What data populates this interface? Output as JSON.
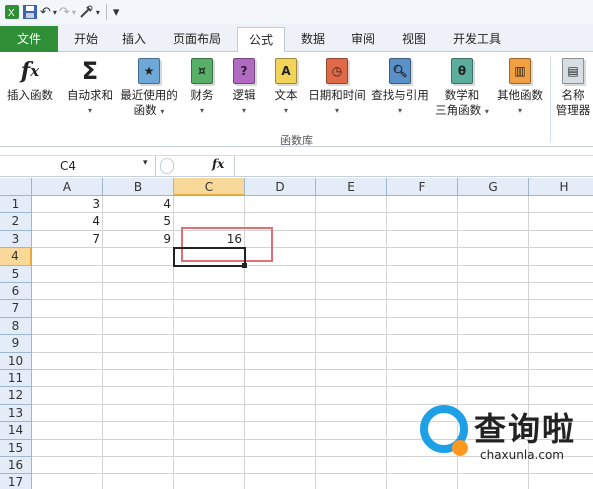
{
  "qat": {
    "undo": "↶",
    "redo": "↷",
    "customize": "▾"
  },
  "tabs": {
    "file": "文件",
    "home": "开始",
    "insert": "插入",
    "layout": "页面布局",
    "formulas": "公式",
    "data": "数据",
    "review": "审阅",
    "view": "视图",
    "developer": "开发工具"
  },
  "ribbon": {
    "insert_fn": "插入函数",
    "autosum": "自动求和",
    "recent": "最近使用的",
    "recent2": "函数",
    "financial": "财务",
    "logical": "逻辑",
    "text": "文本",
    "datetime": "日期和时间",
    "lookup": "查找与引用",
    "math": "数学和",
    "math2": "三角函数",
    "more": "其他函数",
    "name": "名称",
    "name2": "管理器",
    "group_label": "函数库"
  },
  "formula_bar": {
    "name_box": "C4",
    "fx": "fx",
    "content": ""
  },
  "columns": [
    "A",
    "B",
    "C",
    "D",
    "E",
    "F",
    "G",
    "H"
  ],
  "rows": [
    "1",
    "2",
    "3",
    "4",
    "5",
    "6",
    "7",
    "8",
    "9",
    "10",
    "11",
    "12",
    "13",
    "14",
    "15",
    "16",
    "17"
  ],
  "cells": {
    "A1": "3",
    "B1": "4",
    "A2": "4",
    "B2": "5",
    "A3": "7",
    "B3": "9",
    "C3": "16"
  },
  "watermark": {
    "name": "查询啦",
    "url": "chaxunla.com"
  },
  "colors": {
    "file_tab": "#2f8f36",
    "selection_header": "#f9d99a",
    "red_box": "#e07078",
    "logo_ring": "#1da0e6",
    "logo_dot": "#ff9a1f"
  }
}
